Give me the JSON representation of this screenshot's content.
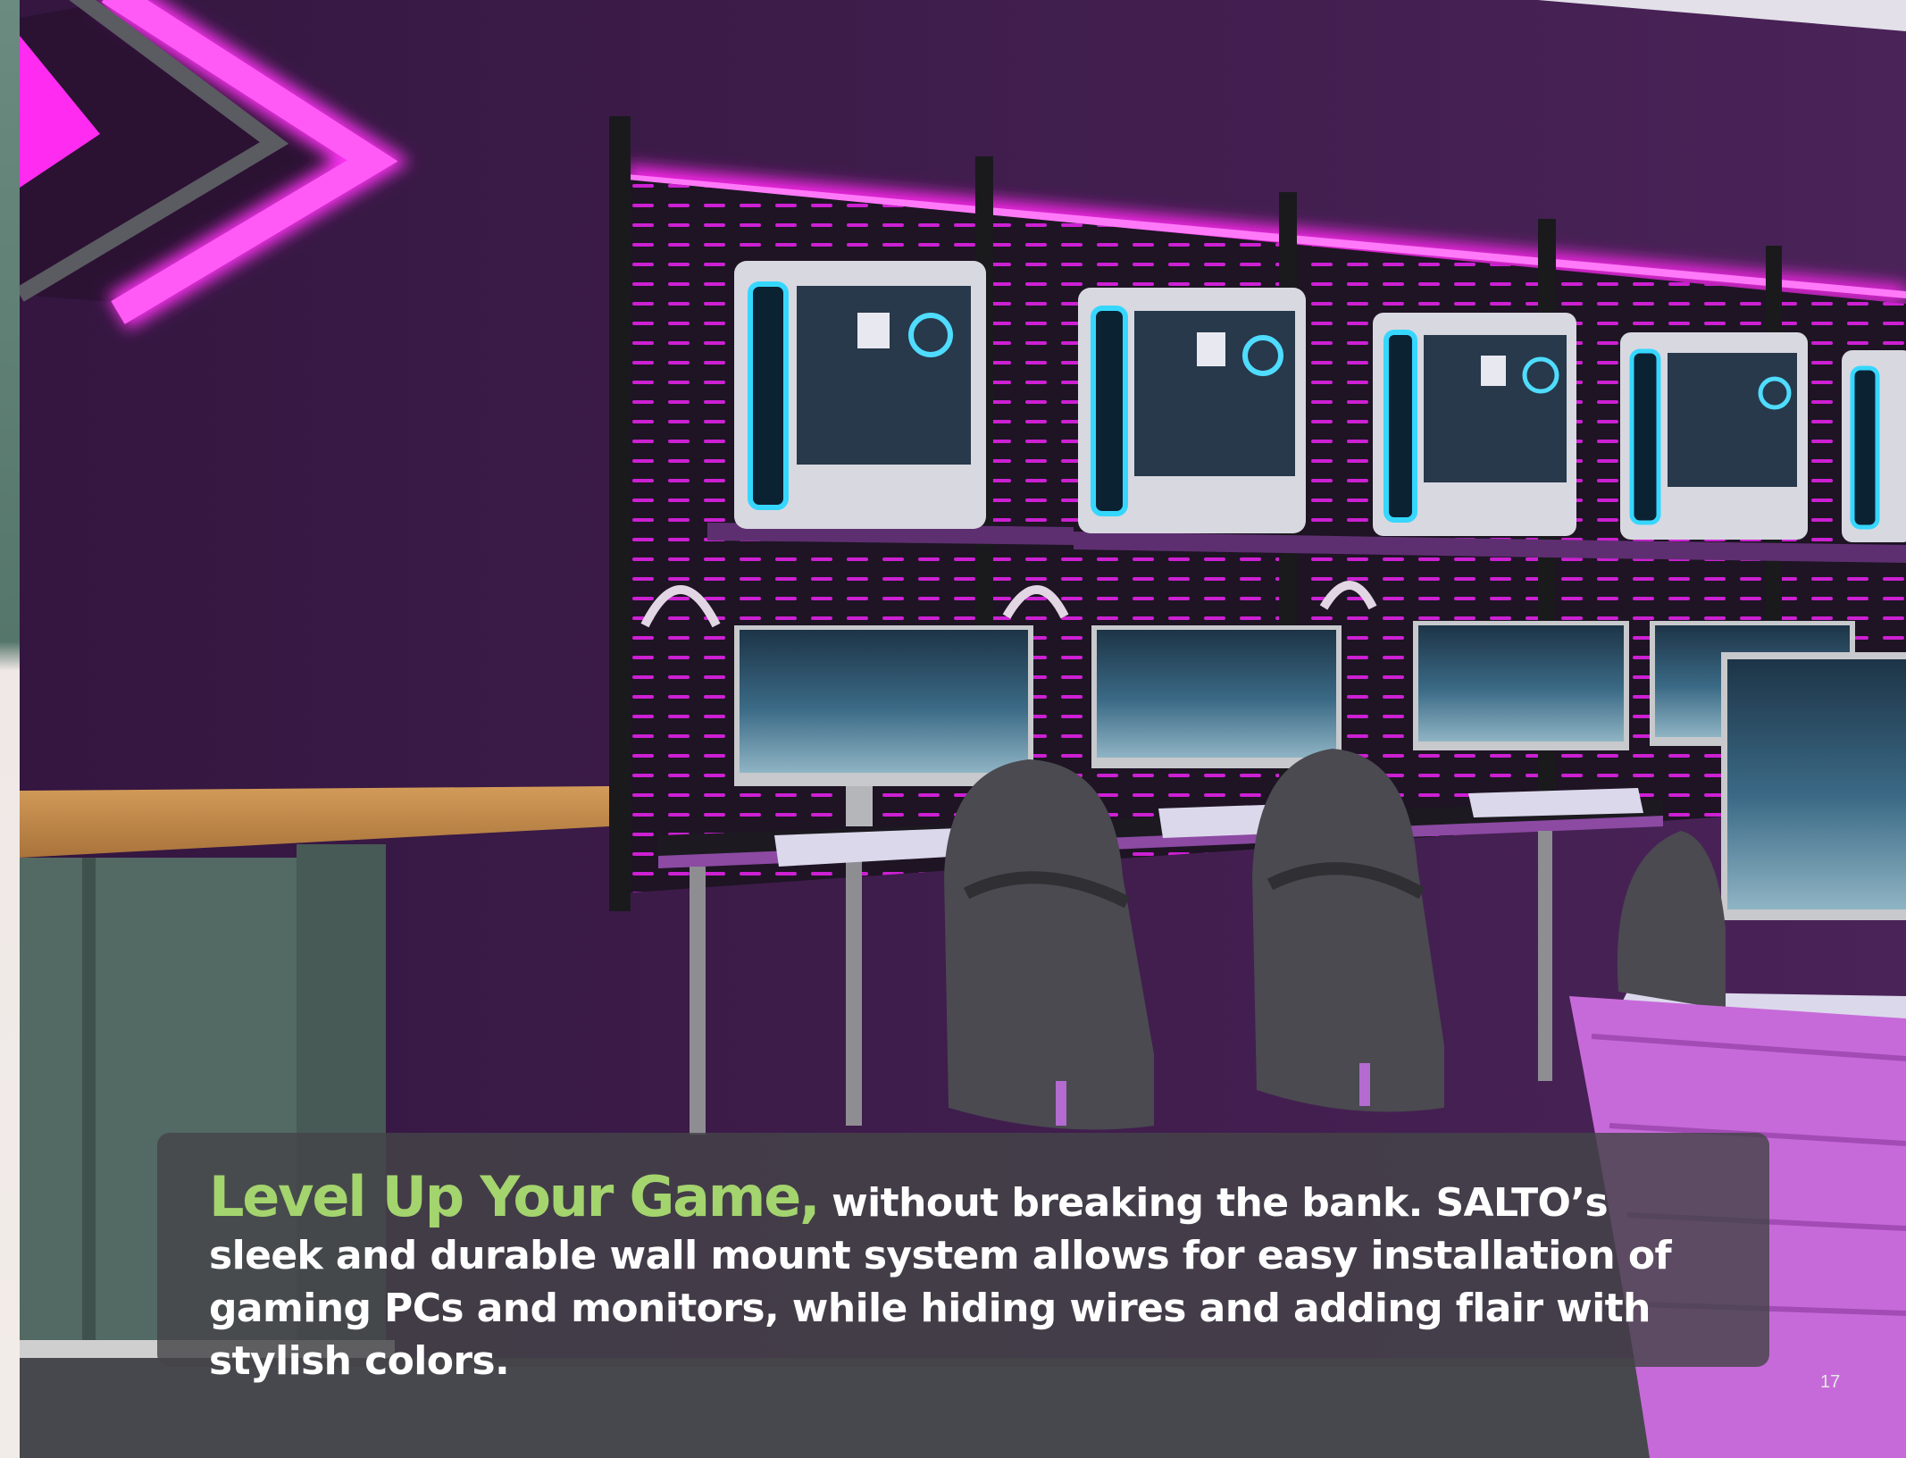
{
  "photo": {
    "subject": "gaming lab with wall-mounted PCs, monitors, gaming chairs and neon purple lighting",
    "colors": {
      "wall": "#3a1d47",
      "neon": "#ff2bf0",
      "accent_purple": "#c76ad9",
      "counter_wood": "#c0894a",
      "cabinet": "#546a64",
      "carpet": "#47484d"
    }
  },
  "caption": {
    "headline": "Level Up Your Game,",
    "body": " without breaking the bank. SALTO’s sleek and durable wall mount system allows for easy installation of gaming PCs and monitors, while hiding wires and adding flair with stylish colors.",
    "headline_color": "#a4d46e",
    "body_color": "#ffffff",
    "box_color": "#444448"
  },
  "page_number": "17"
}
